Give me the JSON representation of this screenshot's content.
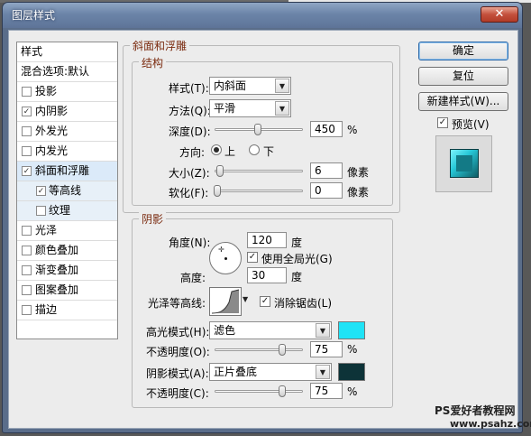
{
  "window": {
    "title": "图层样式",
    "close_icon": "close-icon"
  },
  "sidebar": {
    "header": "样式",
    "blend": "混合选项:默认",
    "items": [
      {
        "label": "投影",
        "checked": false
      },
      {
        "label": "内阴影",
        "checked": true
      },
      {
        "label": "外发光",
        "checked": false
      },
      {
        "label": "内发光",
        "checked": false
      },
      {
        "label": "斜面和浮雕",
        "checked": true,
        "selected": true
      },
      {
        "label": "等高线",
        "checked": true,
        "sub": true
      },
      {
        "label": "纹理",
        "checked": false,
        "sub": true
      },
      {
        "label": "光泽",
        "checked": false
      },
      {
        "label": "颜色叠加",
        "checked": false
      },
      {
        "label": "渐变叠加",
        "checked": false
      },
      {
        "label": "图案叠加",
        "checked": false
      },
      {
        "label": "描边",
        "checked": false
      }
    ]
  },
  "bevel": {
    "group_title": "斜面和浮雕",
    "structure_title": "结构",
    "style_label": "样式(T):",
    "style_value": "内斜面",
    "technique_label": "方法(Q):",
    "technique_value": "平滑",
    "depth_label": "深度(D):",
    "depth_value": "450",
    "depth_unit": "%",
    "direction_label": "方向:",
    "dir_up": "上",
    "dir_down": "下",
    "size_label": "大小(Z):",
    "size_value": "6",
    "size_unit": "像素",
    "soften_label": "软化(F):",
    "soften_value": "0",
    "soften_unit": "像素"
  },
  "shading": {
    "title": "阴影",
    "angle_label": "角度(N):",
    "angle_value": "120",
    "angle_unit": "度",
    "global_light": "使用全局光(G)",
    "altitude_label": "高度:",
    "altitude_value": "30",
    "altitude_unit": "度",
    "gloss_label": "光泽等高线:",
    "antialias": "消除锯齿(L)",
    "highlight_label": "高光模式(H):",
    "highlight_value": "滤色",
    "highlight_color": "#1fe3f6",
    "hl_opacity_label": "不透明度(O):",
    "hl_opacity_value": "75",
    "hl_opacity_unit": "%",
    "shadow_label": "阴影模式(A):",
    "shadow_value": "正片叠底",
    "shadow_color": "#0d3338",
    "sh_opacity_label": "不透明度(C):",
    "sh_opacity_value": "75",
    "sh_opacity_unit": "%"
  },
  "buttons": {
    "ok": "确定",
    "reset": "复位",
    "new_style": "新建样式(W)...",
    "preview": "预览(V)"
  },
  "watermark": {
    "line1": "PS爱好者教程网",
    "line2": "www.psahz.com"
  }
}
